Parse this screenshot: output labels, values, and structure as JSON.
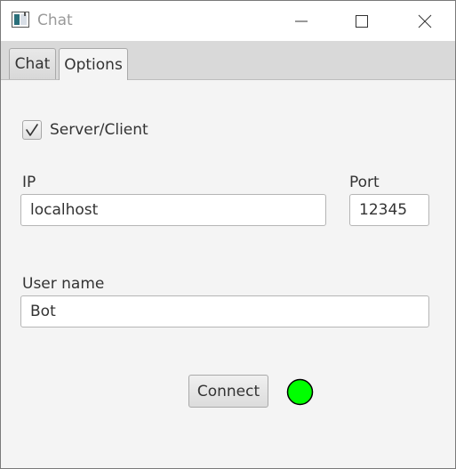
{
  "window": {
    "title": "Chat"
  },
  "tabs": [
    {
      "label": "Chat",
      "selected": false
    },
    {
      "label": "Options",
      "selected": true
    }
  ],
  "options": {
    "server_client": {
      "label": "Server/Client",
      "checked": true
    },
    "ip": {
      "label": "IP",
      "value": "localhost"
    },
    "port": {
      "label": "Port",
      "value": "12345"
    },
    "user_name": {
      "label": "User name",
      "value": "Bot"
    },
    "connect_label": "Connect",
    "status": {
      "color": "#00ff00",
      "icon": "status-indicator-icon"
    }
  },
  "colors": {
    "status_green": "#00ff00",
    "title_text": "#9a9a9a"
  }
}
